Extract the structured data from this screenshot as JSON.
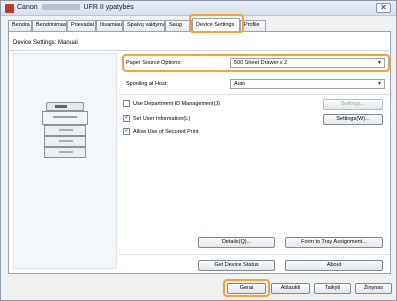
{
  "window": {
    "title_prefix": "Canon",
    "title_suffix": "UFR II ypatybės",
    "close_glyph": "✕"
  },
  "tabs": [
    {
      "label": "Bendra"
    },
    {
      "label": "Bendrinimas"
    },
    {
      "label": "Prievadai"
    },
    {
      "label": "Išsamiau"
    },
    {
      "label": "Spalvų valdymas"
    },
    {
      "label": "Saug"
    },
    {
      "label": "Device Settings"
    },
    {
      "label": "Profile"
    }
  ],
  "panel": {
    "label": "Device Settings: Manual",
    "paper_source_label": "Paper Source Options:",
    "paper_source_value": "500 Sheet Drawer x 2",
    "spooling_label": "Spooling at Host:",
    "spooling_value": "Auto",
    "dept_id_label": "Use Department ID Management(J)",
    "dept_settings_button": "Settings...",
    "user_info_label": "Set User Information(L)",
    "user_settings_button": "Settings(W)...",
    "secured_print_label": "Allow Use of Secured Print",
    "details_button": "Details(Q)...",
    "form_to_tray_button": "Form to Tray Assignment...",
    "get_status_button": "Get Device Status",
    "about_button": "About"
  },
  "footer": {
    "ok_button": "Gerai",
    "cancel_button": "Atšaukti",
    "apply_button": "Taikyti",
    "help_button": "Žinynas"
  },
  "colors": {
    "highlight": "#f0a43a"
  }
}
